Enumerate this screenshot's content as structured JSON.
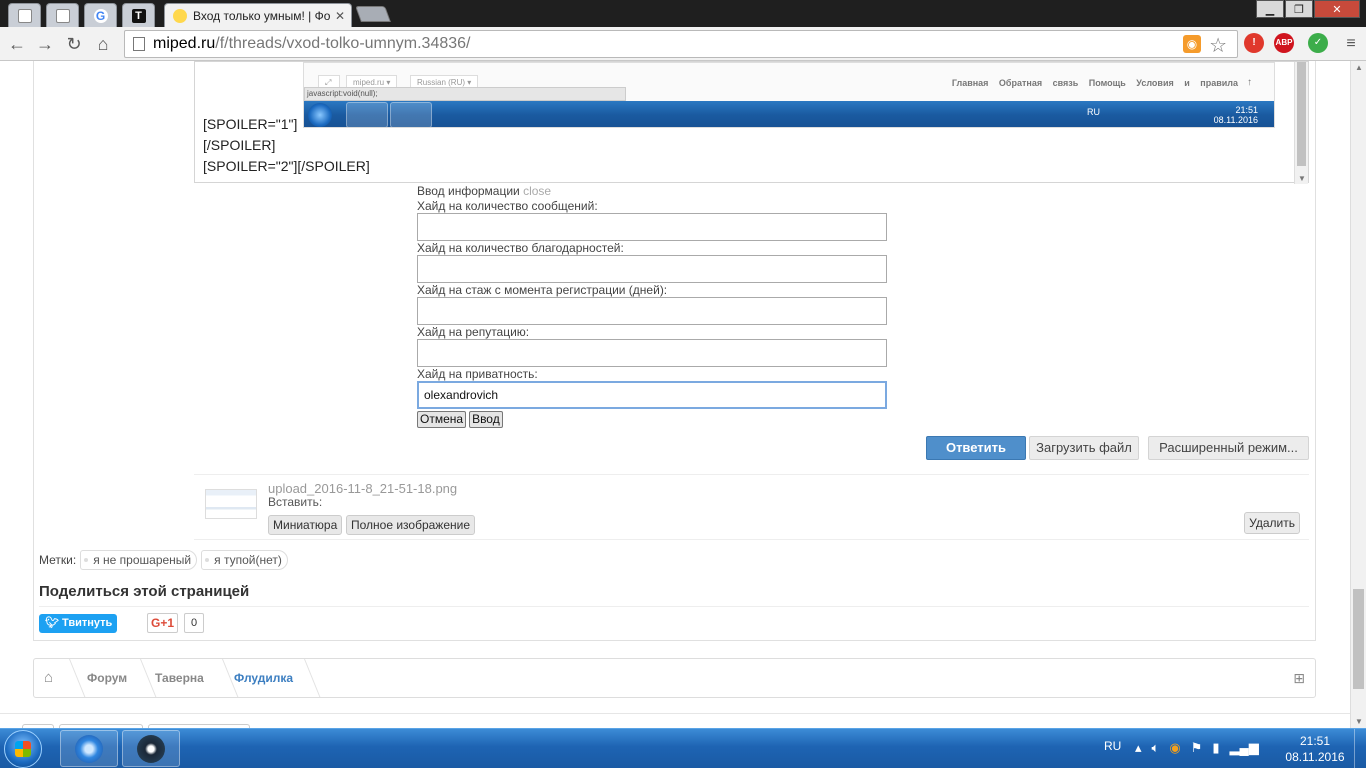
{
  "browser": {
    "active_tab_title": "Вход только умным! | Фо",
    "url_host": "miped.ru",
    "url_path": "/f/threads/vxod-tolko-umnym.34836/",
    "extensions": [
      "warning-ext-icon",
      "adblock-ext-icon",
      "shield-ext-icon"
    ],
    "adblock_label": "ABP"
  },
  "embedded_screenshot": {
    "pill_site": "miped.ru ▾",
    "pill_lang": "Russian (RU) ▾",
    "nav_links": "Главная Обратная связь Помощь Условия и правила",
    "status_text": "javascript:void(null);",
    "tray_lang": "RU",
    "tray_time": "21:51",
    "tray_date": "08.11.2016"
  },
  "editor": {
    "lines": [
      "[SPOILER=\"1\"]",
      "[/SPOILER]",
      "[SPOILER=\"2\"][/SPOILER]"
    ]
  },
  "hide_form": {
    "title": "Ввод информации",
    "close_link": "close",
    "fields": [
      {
        "label": "Хайд на количество сообщений:",
        "value": ""
      },
      {
        "label": "Хайд на количество благодарностей:",
        "value": ""
      },
      {
        "label": "Хайд на стаж с момента регистрации (дней):",
        "value": ""
      },
      {
        "label": "Хайд на репутацию:",
        "value": ""
      },
      {
        "label": "Хайд на приватность:",
        "value": "olexandrovich"
      }
    ],
    "cancel_label": "Отмена",
    "submit_label": "Ввод"
  },
  "reply_actions": {
    "reply_label": "Ответить",
    "upload_label": "Загрузить файл",
    "advanced_label": "Расширенный режим..."
  },
  "attachment": {
    "filename": "upload_2016-11-8_21-51-18.png",
    "insert_label": "Вставить:",
    "thumb_label": "Миниатюра",
    "full_label": "Полное изображение",
    "delete_label": "Удалить"
  },
  "tags": {
    "label": "Метки:",
    "items": [
      "я не прошареный",
      "я тупой(нет)"
    ]
  },
  "share": {
    "title": "Поделиться этой страницей",
    "tweet_label": "Твитнуть",
    "gplus_label": "G+1",
    "gplus_count": "0"
  },
  "breadcrumb": {
    "items": [
      "Форум",
      "Таверна",
      "Флудилка"
    ]
  },
  "taskbar": {
    "lang": "RU",
    "time": "21:51",
    "date": "08.11.2016"
  }
}
